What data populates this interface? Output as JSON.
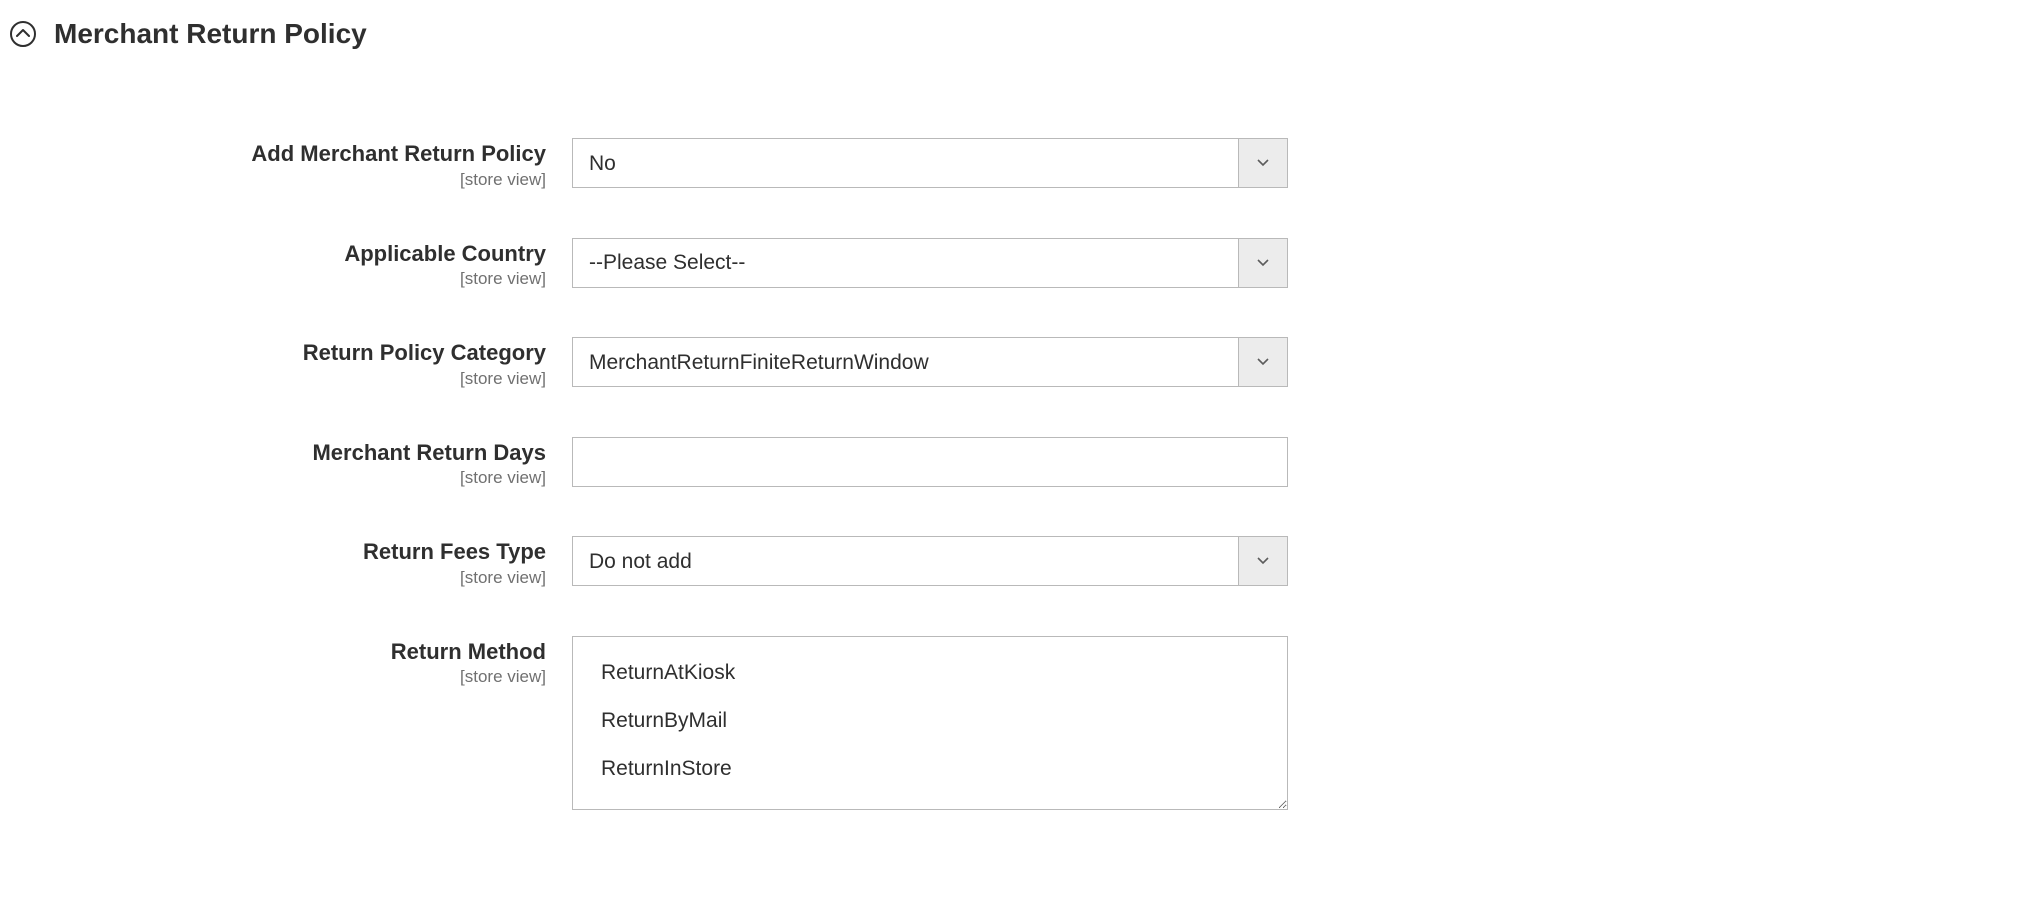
{
  "section": {
    "title": "Merchant Return Policy"
  },
  "scope_label": "[store view]",
  "fields": {
    "add_policy": {
      "label": "Add Merchant Return Policy",
      "value": "No"
    },
    "applicable_country": {
      "label": "Applicable Country",
      "value": "--Please Select--"
    },
    "return_policy_category": {
      "label": "Return Policy Category",
      "value": "MerchantReturnFiniteReturnWindow"
    },
    "merchant_return_days": {
      "label": "Merchant Return Days",
      "value": ""
    },
    "return_fees_type": {
      "label": "Return Fees Type",
      "value": "Do not add"
    },
    "return_method": {
      "label": "Return Method",
      "options": [
        "ReturnAtKiosk",
        "ReturnByMail",
        "ReturnInStore"
      ]
    }
  }
}
